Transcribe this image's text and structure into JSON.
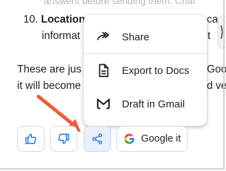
{
  "article": {
    "line1_text": "answers before sending them. Chat",
    "item_number": "10.",
    "item_title": "Location",
    "item_rest": "ca",
    "line3_text": "informat",
    "line3_right": "t",
    "para_left": "These are jus",
    "para_right": "Goo",
    "para2_left": "it will become",
    "para2_right": "d ve"
  },
  "share_menu": {
    "items": [
      {
        "label": "Share",
        "icon": "share-forward-icon"
      },
      {
        "label": "Export to Docs",
        "icon": "docs-icon"
      },
      {
        "label": "Draft in Gmail",
        "icon": "gmail-icon"
      }
    ]
  },
  "actions": {
    "thumbs_up_icon": "thumbs-up-icon",
    "thumbs_down_icon": "thumbs-down-icon",
    "share_icon": "share-icon",
    "google_button_label": "Google it"
  },
  "colors": {
    "accent_blue": "#1a73e8",
    "arrow_red": "#ef5a3c",
    "active_button_bg": "#e8f0fe"
  }
}
